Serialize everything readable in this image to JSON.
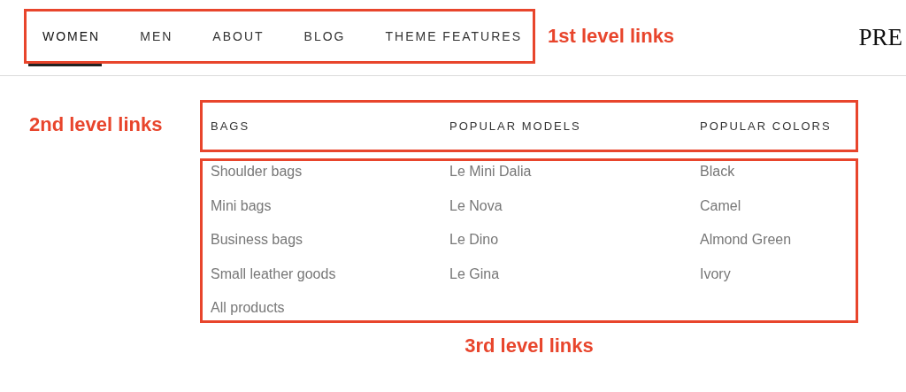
{
  "nav": {
    "items": [
      {
        "label": "WOMEN",
        "selected": true
      },
      {
        "label": "MEN",
        "selected": false
      },
      {
        "label": "ABOUT",
        "selected": false
      },
      {
        "label": "BLOG",
        "selected": false
      },
      {
        "label": "THEME FEATURES",
        "selected": false
      }
    ]
  },
  "logo": "PRE",
  "annotations": [
    "1st level links",
    "2nd level links",
    "3rd level links"
  ],
  "mega_menu": {
    "columns": [
      {
        "heading": "BAGS",
        "links": [
          "Shoulder bags",
          "Mini bags",
          "Business bags",
          "Small leather goods",
          "All products"
        ]
      },
      {
        "heading": "POPULAR MODELS",
        "links": [
          "Le Mini Dalia",
          "Le Nova",
          "Le Dino",
          "Le Gina"
        ]
      },
      {
        "heading": "POPULAR COLORS",
        "links": [
          "Black",
          "Camel",
          "Almond Green",
          "Ivory"
        ]
      }
    ]
  }
}
